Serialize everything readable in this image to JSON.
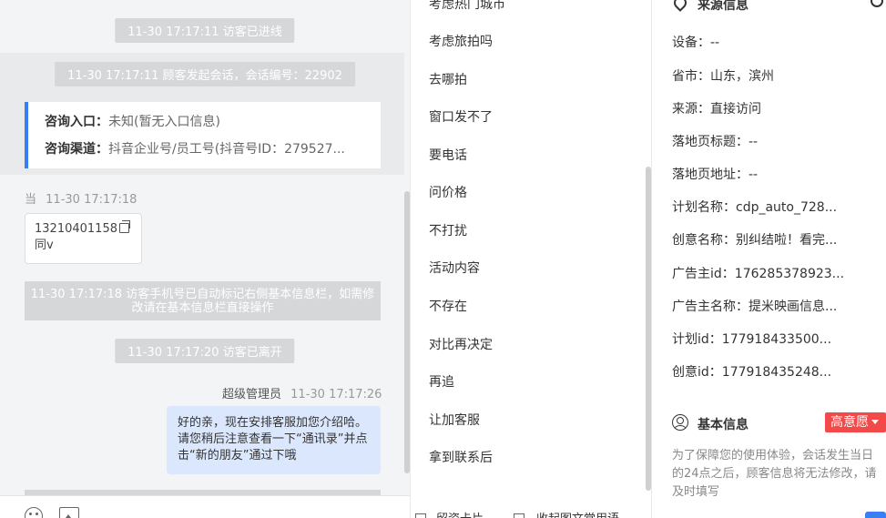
{
  "chat": {
    "events": {
      "visitor_entered": "11-30 17:17:11 访客已进线",
      "session_started": "11-30 17:17:11 顾客发起会话，会话编号：22902",
      "phone_marked": "11-30 17:17:18 访客手机号已自动标记右侧基本信息栏，如需修改请在基本信息栏直接操作",
      "visitor_left": "11-30 17:17:20 访客已离开"
    },
    "inquiry_card": {
      "entry_label": "咨询入口：",
      "entry_value": "未知(暂无入口信息)",
      "channel_label": "咨询渠道：",
      "channel_value": "抖音企业号/员工号(抖音号ID：279527..."
    },
    "visitor_message": {
      "sender": "当",
      "time": "11-30 17:17:18",
      "phone": "13210401158",
      "text": "同v"
    },
    "agent_message": {
      "sender": "超级管理员",
      "time": "11-30 17:17:26",
      "text": "好的亲，现在安排客服加您介绍哈。请您稍后注意查看一下“通讯录”并点击“新的朋友”通过下哦"
    }
  },
  "quick_replies": {
    "items": [
      "考虑热门城市",
      "考虑旅拍吗",
      "去哪拍",
      "窗口发不了",
      "要电话",
      "问价格",
      "不打扰",
      "活动内容",
      "不存在",
      "对比再决定",
      "再追",
      "让加客服",
      "拿到联系后"
    ],
    "bottom": {
      "lead_card": "留资卡片",
      "collapse": "收起图文常用语"
    }
  },
  "source_info": {
    "title": "来源信息",
    "fields": [
      {
        "label": "设备：",
        "value": "--"
      },
      {
        "label": "省市：",
        "value": "山东，滨州"
      },
      {
        "label": "来源：",
        "value": "直接访问"
      },
      {
        "label": "落地页标题：",
        "value": "--"
      },
      {
        "label": "落地页地址：",
        "value": "--"
      },
      {
        "label": "计划名称：",
        "value": "cdp_auto_728..."
      },
      {
        "label": "创意名称：",
        "value": "别纠结啦！看完..."
      },
      {
        "label": "广告主id：",
        "value": "176285378923..."
      },
      {
        "label": "广告主名称：",
        "value": "提米映画信息..."
      },
      {
        "label": "计划id：",
        "value": "177918433500..."
      },
      {
        "label": "创意id：",
        "value": "177918435248..."
      }
    ]
  },
  "basic_info": {
    "title": "基本信息",
    "intent": "高意愿",
    "notice": "为了保障您的使用体验，会话发生当日的24点之后，顾客信息将无法修改，请及时填写"
  },
  "colors": {
    "accent_blue": "#3a7ef5",
    "agent_bubble": "#dbe7fd",
    "intent_red": "#f24a4a",
    "system_pill": "#d6d7d9"
  }
}
